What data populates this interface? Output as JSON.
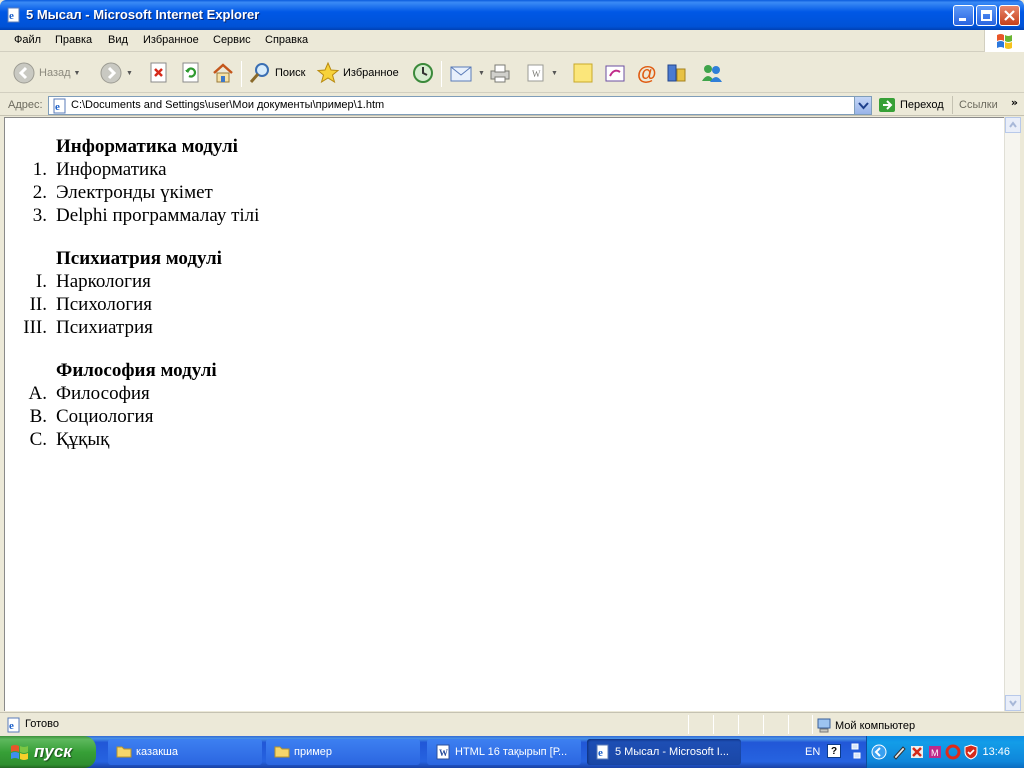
{
  "window": {
    "title": "5 Мысал - Microsoft Internet Explorer"
  },
  "menu": {
    "items": [
      "Файл",
      "Правка",
      "Вид",
      "Избранное",
      "Сервис",
      "Справка"
    ]
  },
  "toolbar": {
    "back_label": "Назад",
    "search_label": "Поиск",
    "favorites_label": "Избранное"
  },
  "address": {
    "label": "Адрес:",
    "url": "C:\\Documents and Settings\\user\\Мои документы\\пример\\1.htm",
    "go_label": "Переход",
    "links_label": "Ссылки"
  },
  "document": {
    "sections": [
      {
        "heading": "Информатика модулі",
        "items": [
          {
            "marker": "1.",
            "text": "Информатика"
          },
          {
            "marker": "2.",
            "text": "Электронды үкімет"
          },
          {
            "marker": "3.",
            "text": "Delphi программалау тілі"
          }
        ]
      },
      {
        "heading": "Психиатрия модулі",
        "items": [
          {
            "marker": "I.",
            "text": "Наркология"
          },
          {
            "marker": "II.",
            "text": "Психология"
          },
          {
            "marker": "III.",
            "text": "Психиатрия"
          }
        ]
      },
      {
        "heading": "Философия модулі",
        "items": [
          {
            "marker": "A.",
            "text": "Философия"
          },
          {
            "marker": "B.",
            "text": "Социология"
          },
          {
            "marker": "C.",
            "text": "Құқық"
          }
        ]
      }
    ]
  },
  "status": {
    "text": "Готово",
    "zone": "Мой компьютер"
  },
  "taskbar": {
    "start_label": "пуск",
    "tasks": [
      "казакша",
      "пример",
      "HTML 16 тақырып [Р...",
      "5 Мысал - Microsoft I..."
    ],
    "language": "EN",
    "clock": "13:46"
  },
  "colors": {
    "titlebar": "#0058e6",
    "taskbar": "#2663e0",
    "start_button": "#37a037",
    "window_chrome": "#ece9d8"
  }
}
